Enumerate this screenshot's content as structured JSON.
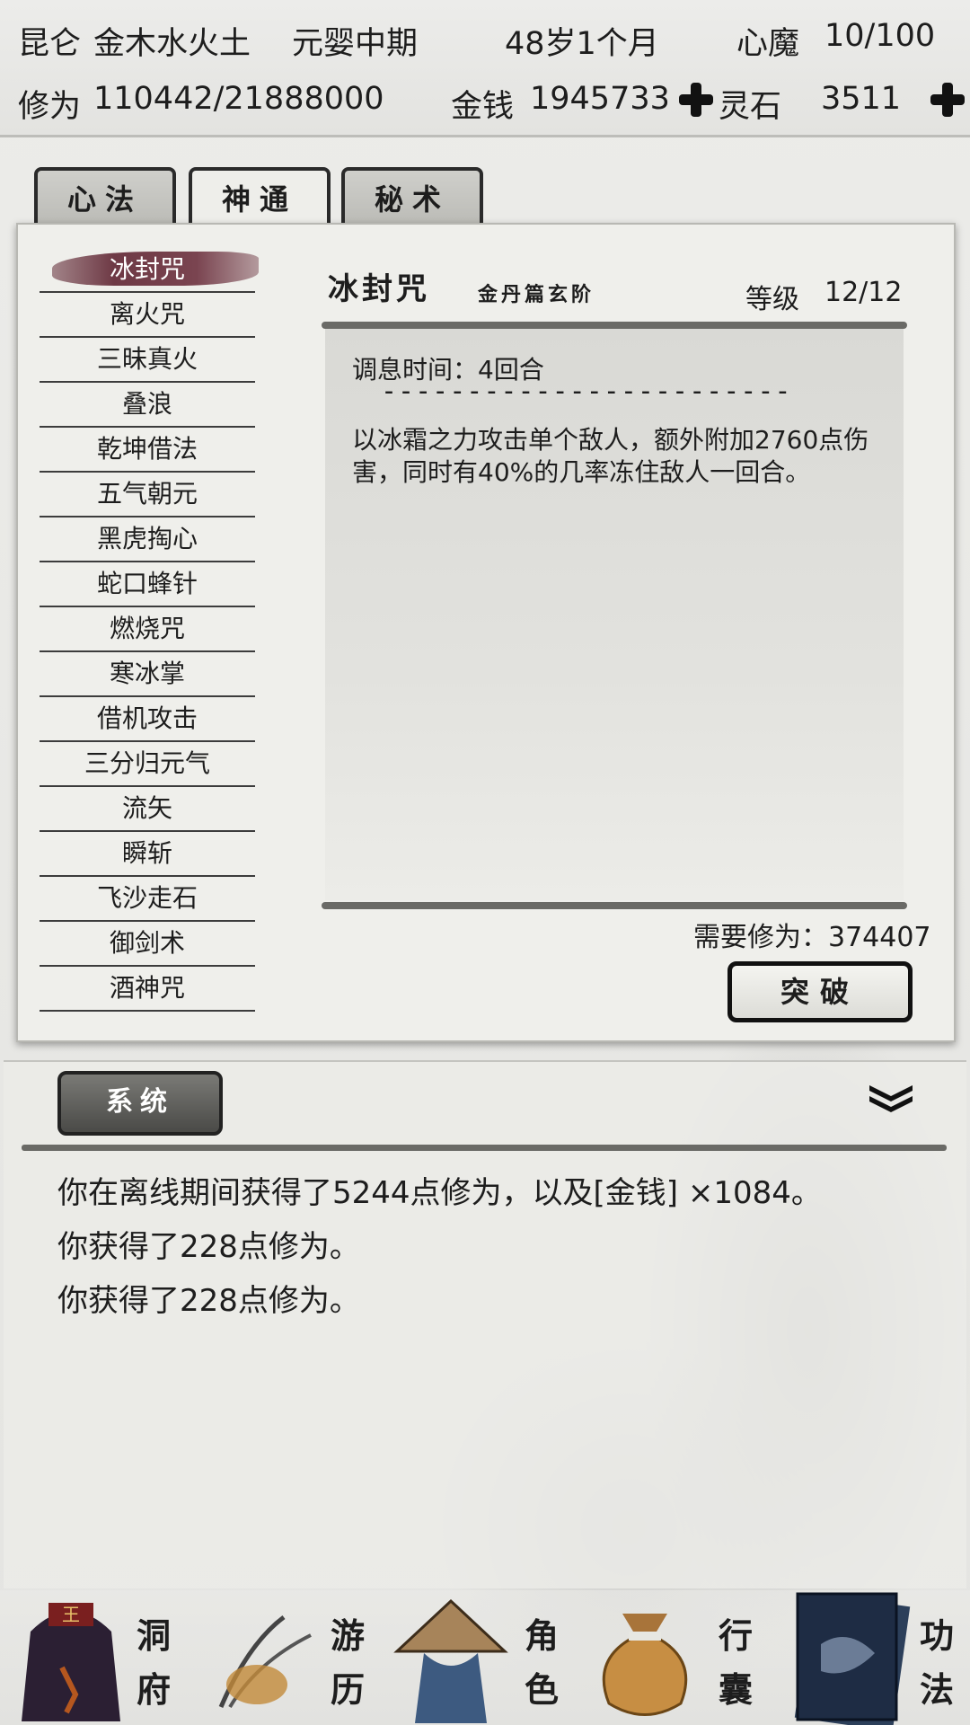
{
  "status": {
    "sect": "昆仑",
    "elements": "金木水火土",
    "realm": "元婴中期",
    "age": "48岁1个月",
    "heart_demon_label": "心魔",
    "heart_demon_value": "10/100",
    "cultivation_label": "修为",
    "cultivation_value": "110442/21888000",
    "money_label": "金钱",
    "money_value": "1945733",
    "spirit_stone_label": "灵石",
    "spirit_stone_value": "3511"
  },
  "tabs": [
    {
      "label": "心法"
    },
    {
      "label": "神通"
    },
    {
      "label": "秘术"
    }
  ],
  "skills": [
    "冰封咒",
    "离火咒",
    "三昧真火",
    "叠浪",
    "乾坤借法",
    "五气朝元",
    "黑虎掏心",
    "蛇口蜂针",
    "燃烧咒",
    "寒冰掌",
    "借机攻击",
    "三分归元气",
    "流矢",
    "瞬斩",
    "飞沙走石",
    "御剑术",
    "酒神咒"
  ],
  "detail": {
    "name": "冰封咒",
    "category": "金丹篇玄阶",
    "level_label": "等级",
    "level_value": "12/12",
    "cooldown": "调息时间：4回合",
    "divider": "------------------------",
    "description": "以冰霜之力攻击单个敌人，额外附加2760点伤害，同时有40%的几率冻住敌人一回合。",
    "required_label": "需要修为：374407",
    "breakthrough_label": "突破"
  },
  "log": {
    "tab_label": "系统",
    "lines": [
      "你在离线期间获得了5244点修为，以及[金钱] ×1084。",
      "你获得了228点修为。",
      "你获得了228点修为。"
    ]
  },
  "nav": [
    {
      "icon": "cave-dwelling-icon",
      "chars": [
        "洞",
        "府"
      ]
    },
    {
      "icon": "travel-icon",
      "chars": [
        "游",
        "历"
      ]
    },
    {
      "icon": "character-icon",
      "chars": [
        "角",
        "色"
      ]
    },
    {
      "icon": "bag-icon",
      "chars": [
        "行",
        "囊"
      ]
    },
    {
      "icon": "scroll-book-icon",
      "chars": [
        "功",
        "法"
      ]
    }
  ],
  "colors": {
    "selected_skill": "#6e3945",
    "panel": "#efefeb",
    "ink": "#1d1d1d"
  }
}
